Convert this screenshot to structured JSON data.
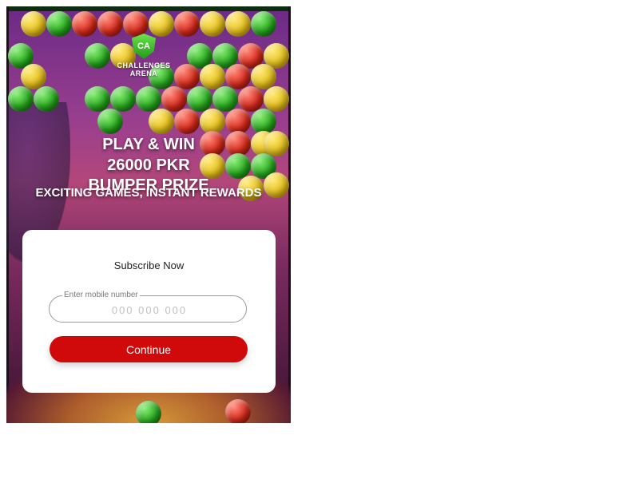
{
  "logo": {
    "monogram": "CA",
    "line1": "CHALLENGES",
    "line2": "ARENA"
  },
  "headline": {
    "line1": "PLAY & WIN",
    "line2": "26000 PKR",
    "line3": "BUMPER PRIZE",
    "tagline": "EXCITING GAMES, INSTANT REWARDS"
  },
  "subscribe": {
    "title": "Subscribe Now",
    "input_label": "Enter mobile number",
    "input_placeholder": "000 000 000",
    "button_label": "Continue"
  },
  "colors": {
    "accent_button": "#d00a0a",
    "logo_green": "#1f9a1a",
    "card_background": "#ffffff"
  }
}
